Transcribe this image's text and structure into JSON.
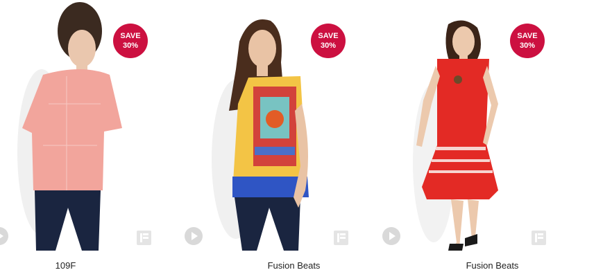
{
  "products": [
    {
      "name": "109F",
      "badge": {
        "line1": "SAVE",
        "line2": "30%"
      },
      "icons": [
        "play-icon",
        "brand-logo-icon"
      ]
    },
    {
      "name": "Fusion Beats",
      "badge": {
        "line1": "SAVE",
        "line2": "30%"
      },
      "icons": [
        "play-icon",
        "brand-logo-icon"
      ]
    },
    {
      "name": "Fusion Beats",
      "badge": {
        "line1": "SAVE",
        "line2": "30%"
      },
      "icons": [
        "play-icon",
        "brand-logo-icon"
      ]
    }
  ],
  "colors": {
    "badge": "#cc1040",
    "icon_gray": "#d9d9d9",
    "text": "#222222"
  }
}
